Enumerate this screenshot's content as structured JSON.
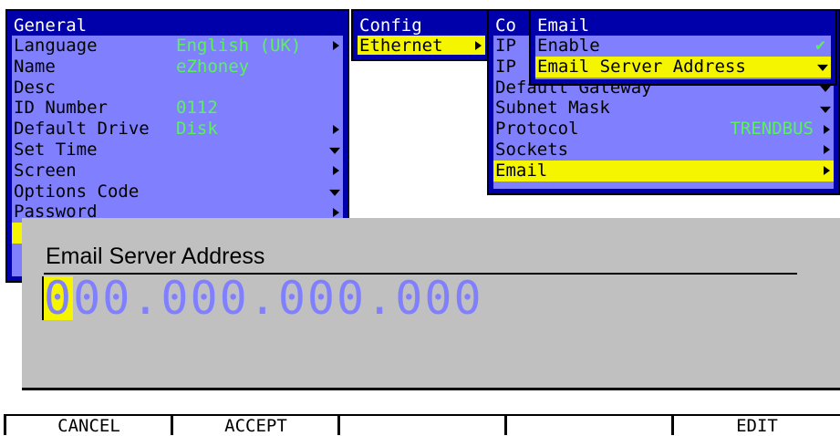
{
  "general_menu": {
    "title": "General",
    "items": [
      {
        "label": "Language",
        "value": "English (UK)",
        "indicator": "right"
      },
      {
        "label": "Name",
        "value": "eZhoney",
        "indicator": ""
      },
      {
        "label": "Desc",
        "value": "",
        "indicator": ""
      },
      {
        "label": "ID Number",
        "value": "0112",
        "indicator": ""
      },
      {
        "label": "Default Drive",
        "value": "Disk",
        "indicator": "right"
      },
      {
        "label": "Set Time",
        "value": "",
        "indicator": "down"
      },
      {
        "label": "Screen",
        "value": "",
        "indicator": "right"
      },
      {
        "label": "Options Code",
        "value": "",
        "indicator": "down"
      },
      {
        "label": "Password",
        "value": "",
        "indicator": "right"
      }
    ]
  },
  "config_menu": {
    "title": "Config",
    "items": [
      {
        "label": "Ethernet",
        "selected": true,
        "indicator": "right"
      }
    ]
  },
  "comms_menu": {
    "title": "Co",
    "items": [
      {
        "label": "IP",
        "value": "",
        "indicator": ""
      },
      {
        "label": "IP",
        "value": "",
        "indicator": ""
      },
      {
        "label": "Default Gateway",
        "value": "",
        "indicator": "down"
      },
      {
        "label": "Subnet Mask",
        "value": "",
        "indicator": "down"
      },
      {
        "label": "Protocol",
        "value": "TRENDBUS",
        "indicator": "right"
      },
      {
        "label": "Sockets",
        "value": "",
        "indicator": "right"
      },
      {
        "label": "Email",
        "value": "",
        "indicator": "right",
        "selected": true
      }
    ]
  },
  "email_menu": {
    "title": "Email",
    "items": [
      {
        "label": "Enable",
        "check": "✔",
        "indicator": ""
      },
      {
        "label": "Email Server Address",
        "selected": true,
        "indicator": "down"
      }
    ]
  },
  "dialog": {
    "title": "Email Server Address",
    "ip_first_char": "0",
    "ip_rest": "00.000.000.000"
  },
  "softkeys": [
    "CANCEL",
    "ACCEPT",
    "",
    "",
    "EDIT"
  ],
  "colors": {
    "menu_bg": "#8080ff",
    "menu_border": "#0000aa",
    "highlight": "#f5f500",
    "value_green": "#5af25a",
    "dialog_bg": "#c0c0c0"
  }
}
